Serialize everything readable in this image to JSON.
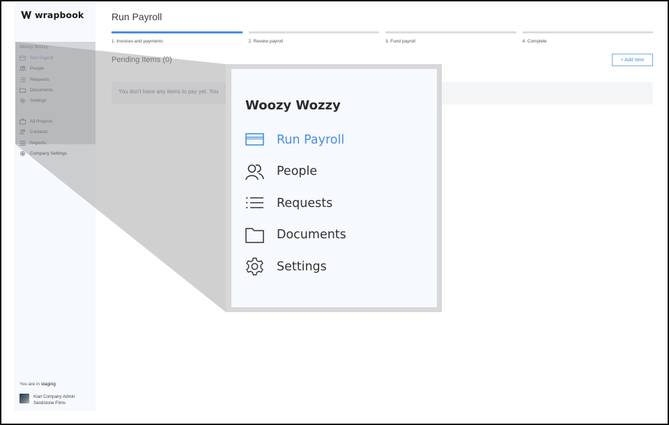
{
  "app": {
    "brand": "wrapbook",
    "accent": "#4a8fdd"
  },
  "sidebar": {
    "project_name": "Woozy Wozzy",
    "project_items": [
      {
        "label": "Run Payroll",
        "icon": "card-icon",
        "active": true
      },
      {
        "label": "People",
        "icon": "people-icon"
      },
      {
        "label": "Requests",
        "icon": "list-icon"
      },
      {
        "label": "Documents",
        "icon": "folder-icon"
      },
      {
        "label": "Settings",
        "icon": "gear-icon"
      }
    ],
    "global_items": [
      {
        "label": "All Projects",
        "icon": "briefcase-icon"
      },
      {
        "label": "Contacts",
        "icon": "people-icon"
      },
      {
        "label": "Reports",
        "icon": "menu-icon"
      },
      {
        "label": "Company Settings",
        "icon": "gear-icon"
      }
    ],
    "environment_prefix": "You are in ",
    "environment": "staging",
    "user": {
      "name": "Kian Company Admin",
      "company": "Sandstone Films"
    }
  },
  "main": {
    "title": "Run Payroll",
    "steps": [
      {
        "label": "1. Invoices and payments",
        "active": true
      },
      {
        "label": "2. Review payroll"
      },
      {
        "label": "3. Fund payroll"
      },
      {
        "label": "4. Complete"
      }
    ],
    "pending_title": "Pending Items (0)",
    "add_item_label": "+ Add Item",
    "empty_message": "You don't have any items to pay yet. You"
  },
  "zoom": {
    "title": "Woozy Wozzy",
    "items": [
      {
        "label": "Run Payroll",
        "icon": "card-icon",
        "active": true
      },
      {
        "label": "People",
        "icon": "people-icon"
      },
      {
        "label": "Requests",
        "icon": "list-icon"
      },
      {
        "label": "Documents",
        "icon": "folder-icon"
      },
      {
        "label": "Settings",
        "icon": "gear-icon"
      }
    ]
  }
}
